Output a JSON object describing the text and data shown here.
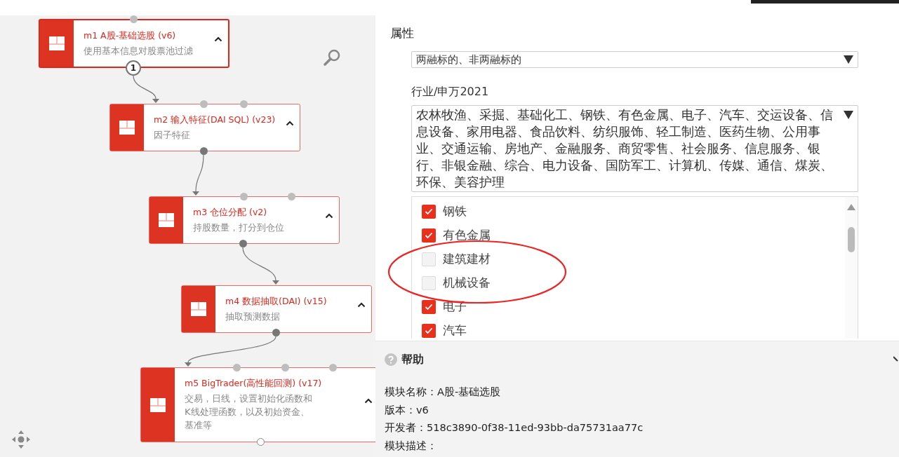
{
  "canvas": {
    "nodes": [
      {
        "title": "m1 A股-基础选股 (v6)",
        "description": "使用基本信息对股票池过滤",
        "selected": true,
        "output_label": "1"
      },
      {
        "title": "m2 输入特征(DAI SQL) (v23)",
        "description": "因子特征",
        "selected": false
      },
      {
        "title": "m3 仓位分配 (v2)",
        "description": "持股数量，打分到仓位",
        "selected": false
      },
      {
        "title": "m4 数据抽取(DAI) (v15)",
        "description": "抽取预测数据",
        "selected": false
      },
      {
        "title": "m5 BigTrader(高性能回测) (v17)",
        "description": "交易，日线，设置初始化函数和K线处理函数，以及初始资金、基准等",
        "selected": false
      }
    ]
  },
  "properties": {
    "heading": "属性",
    "attribute_select": {
      "value": "两融标的、非两融标的"
    },
    "industry_label": "行业/申万2021",
    "industry_select": {
      "value": "农林牧渔、采掘、基础化工、钢铁、有色金属、电子、汽车、交运设备、信息设备、家用电器、食品饮料、纺织服饰、轻工制造、医药生物、公用事业、交通运输、房地产、金融服务、商贸零售、社会服务、信息服务、银行、非银金融、综合、电力设备、国防军工、计算机、传媒、通信、煤炭、环保、美容护理"
    },
    "industry_options": [
      {
        "label": "钢铁",
        "checked": true
      },
      {
        "label": "有色金属",
        "checked": true
      },
      {
        "label": "建筑建材",
        "checked": false
      },
      {
        "label": "机械设备",
        "checked": false
      },
      {
        "label": "电子",
        "checked": true
      },
      {
        "label": "汽车",
        "checked": true
      }
    ]
  },
  "help": {
    "title": "帮助",
    "lines": [
      "模块名称：A股-基础选股",
      "版本：v6",
      "开发者：518c3890-0f38-11ed-93bb-da75731aa77c",
      "模块描述："
    ]
  }
}
